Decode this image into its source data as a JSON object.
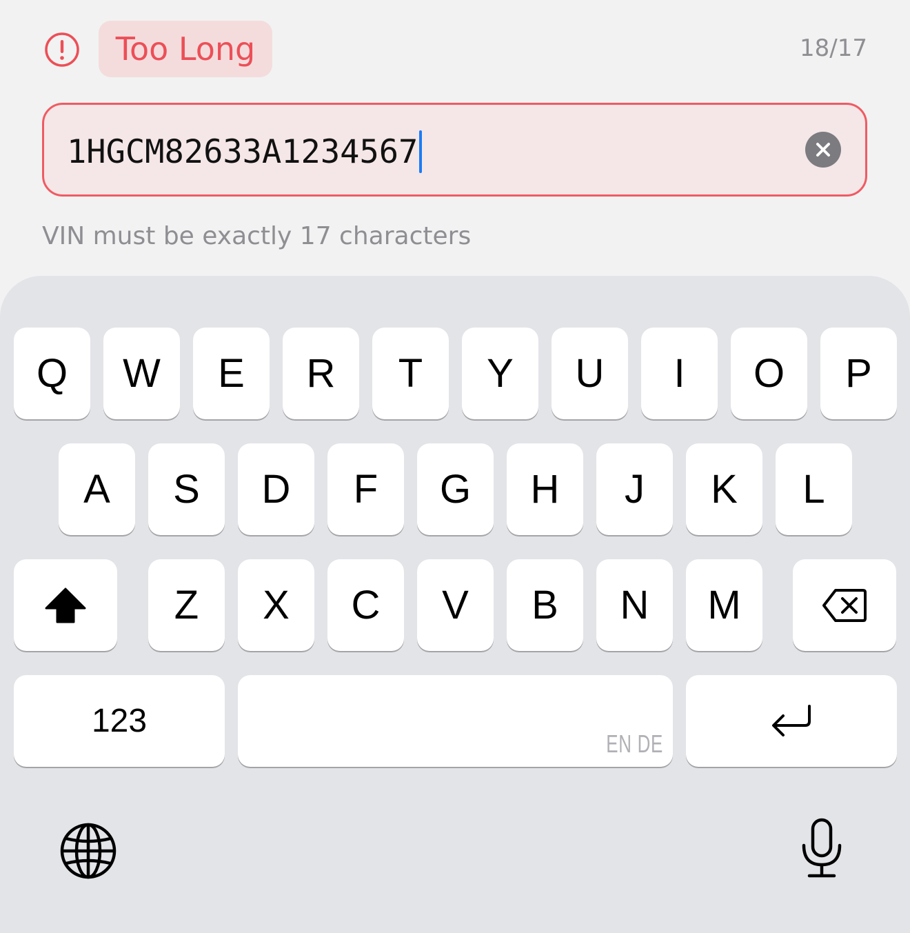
{
  "status": {
    "label": "Too Long",
    "count": "18/17",
    "error_color": "#ec4f57"
  },
  "vin_field": {
    "value": "1HGCM82633A1234567",
    "helper": "VIN must be exactly 17 characters",
    "clear_icon": "clear-x-circle-icon"
  },
  "keyboard": {
    "row1": [
      "Q",
      "W",
      "E",
      "R",
      "T",
      "Y",
      "U",
      "I",
      "O",
      "P"
    ],
    "row2": [
      "A",
      "S",
      "D",
      "F",
      "G",
      "H",
      "J",
      "K",
      "L"
    ],
    "row3": [
      "Z",
      "X",
      "C",
      "V",
      "B",
      "N",
      "M"
    ],
    "numbers_label": "123",
    "space_lang_label": "EN DE",
    "icons": {
      "shift": "shift-arrow-icon",
      "delete": "backspace-icon",
      "return": "return-arrow-icon",
      "globe": "globe-icon",
      "mic": "microphone-icon"
    }
  }
}
